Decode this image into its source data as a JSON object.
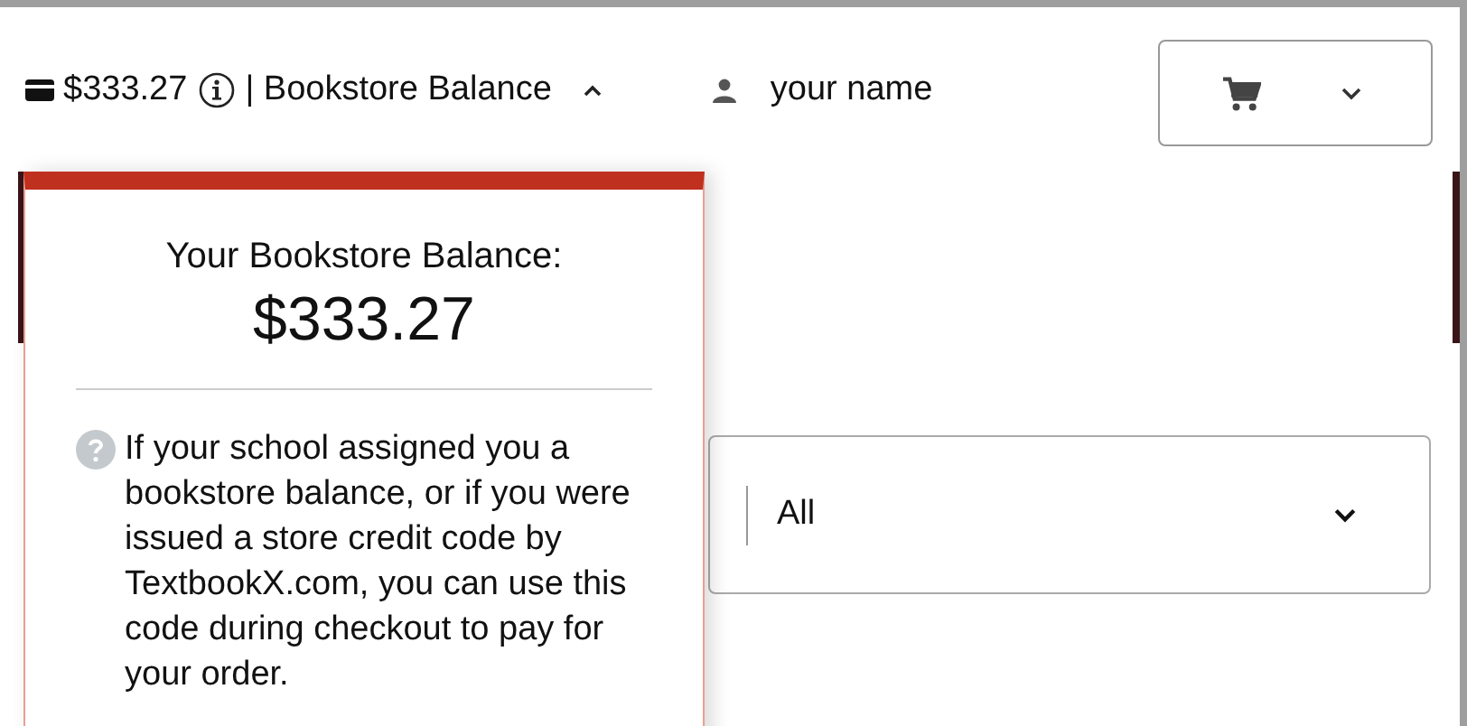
{
  "header": {
    "balance_amount": "$333.27",
    "balance_label": "| Bookstore Balance",
    "balance_expanded": true,
    "user_name": "your name"
  },
  "search": {
    "category": "All"
  },
  "balance_popup": {
    "title": "Your Bookstore Balance:",
    "amount": "$333.27",
    "help_text": "If your school assigned you a bookstore balance, or if you were issued a store credit code by TextbookX.com, you can use this code during checkout to pay for your order."
  }
}
